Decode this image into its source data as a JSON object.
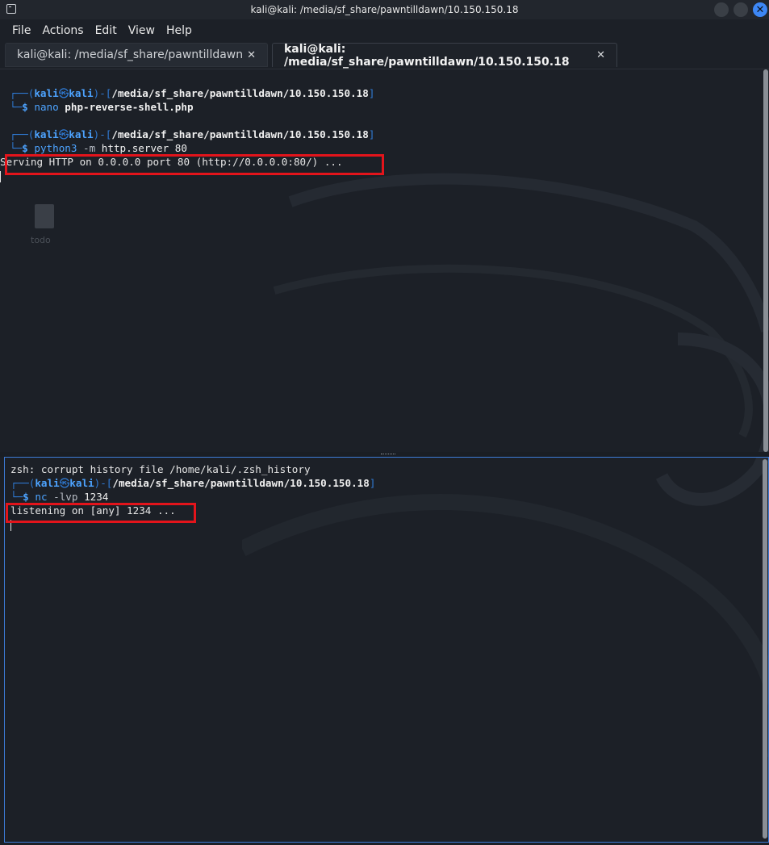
{
  "window": {
    "title": "kali@kali: /media/sf_share/pawntilldawn/10.150.150.18",
    "close_symbol": "✕"
  },
  "menu": [
    "File",
    "Actions",
    "Edit",
    "View",
    "Help"
  ],
  "tabs": [
    {
      "label": "kali@kali: /media/sf_share/pawntilldawn",
      "close": "✕"
    },
    {
      "label": "kali@kali: /media/sf_share/pawntilldawn/10.150.150.18",
      "close": "✕"
    }
  ],
  "desktop": {
    "label": "todo"
  },
  "top_pane": {
    "prompt1": {
      "user": "kali",
      "host": "kali",
      "path": "/media/sf_share/pawntilldawn/10.150.150.18",
      "cmd": "nano",
      "args": "php-reverse-shell.php"
    },
    "prompt2": {
      "user": "kali",
      "host": "kali",
      "path": "/media/sf_share/pawntilldawn/10.150.150.18",
      "cmd": "python3",
      "flag": "-m",
      "args": "http.server 80"
    },
    "output": "Serving HTTP on 0.0.0.0 port 80 (http://0.0.0.0:80/) ..."
  },
  "bottom_pane": {
    "warning": "zsh: corrupt history file /home/kali/.zsh_history",
    "prompt": {
      "user": "kali",
      "host": "kali",
      "path": "/media/sf_share/pawntilldawn/10.150.150.18",
      "cmd": "nc",
      "flag": "-lvp",
      "args": "1234"
    },
    "output": "listening on [any] 1234 ..."
  },
  "prompt_parts": {
    "open_corner": "┌──(",
    "at": "㉿",
    "mid": ")-[",
    "close": "]",
    "dollar_prefix": "└─",
    "dollar": "$"
  },
  "colors": {
    "accent": "#3d87f5",
    "highlight": "#e3141b",
    "prompt": "#4da3ff"
  }
}
